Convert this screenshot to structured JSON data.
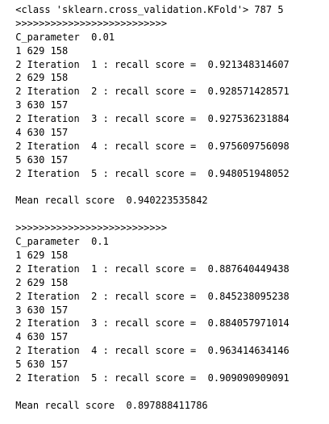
{
  "output": {
    "lines": [
      " <class 'sklearn.cross_validation.KFold'> 787 5",
      " >>>>>>>>>>>>>>>>>>>>>>>>>>",
      " C_parameter  0.01",
      " 1 629 158",
      " 2 Iteration  1 : recall score =  0.921348314607",
      " 2 629 158",
      " 2 Iteration  2 : recall score =  0.928571428571",
      " 3 630 157",
      " 2 Iteration  3 : recall score =  0.927536231884",
      " 4 630 157",
      " 2 Iteration  4 : recall score =  0.975609756098",
      " 5 630 157",
      " 2 Iteration  5 : recall score =  0.948051948052",
      "",
      " Mean recall score  0.940223535842",
      "",
      " >>>>>>>>>>>>>>>>>>>>>>>>>>",
      " C_parameter  0.1",
      " 1 629 158",
      " 2 Iteration  1 : recall score =  0.887640449438",
      " 2 629 158",
      " 2 Iteration  2 : recall score =  0.845238095238",
      " 3 630 157",
      " 2 Iteration  3 : recall score =  0.884057971014",
      " 4 630 157",
      " 2 Iteration  4 : recall score =  0.963414634146",
      " 5 630 157",
      " 2 Iteration  5 : recall score =  0.909090909091",
      "",
      " Mean recall score  0.897888411786"
    ]
  }
}
